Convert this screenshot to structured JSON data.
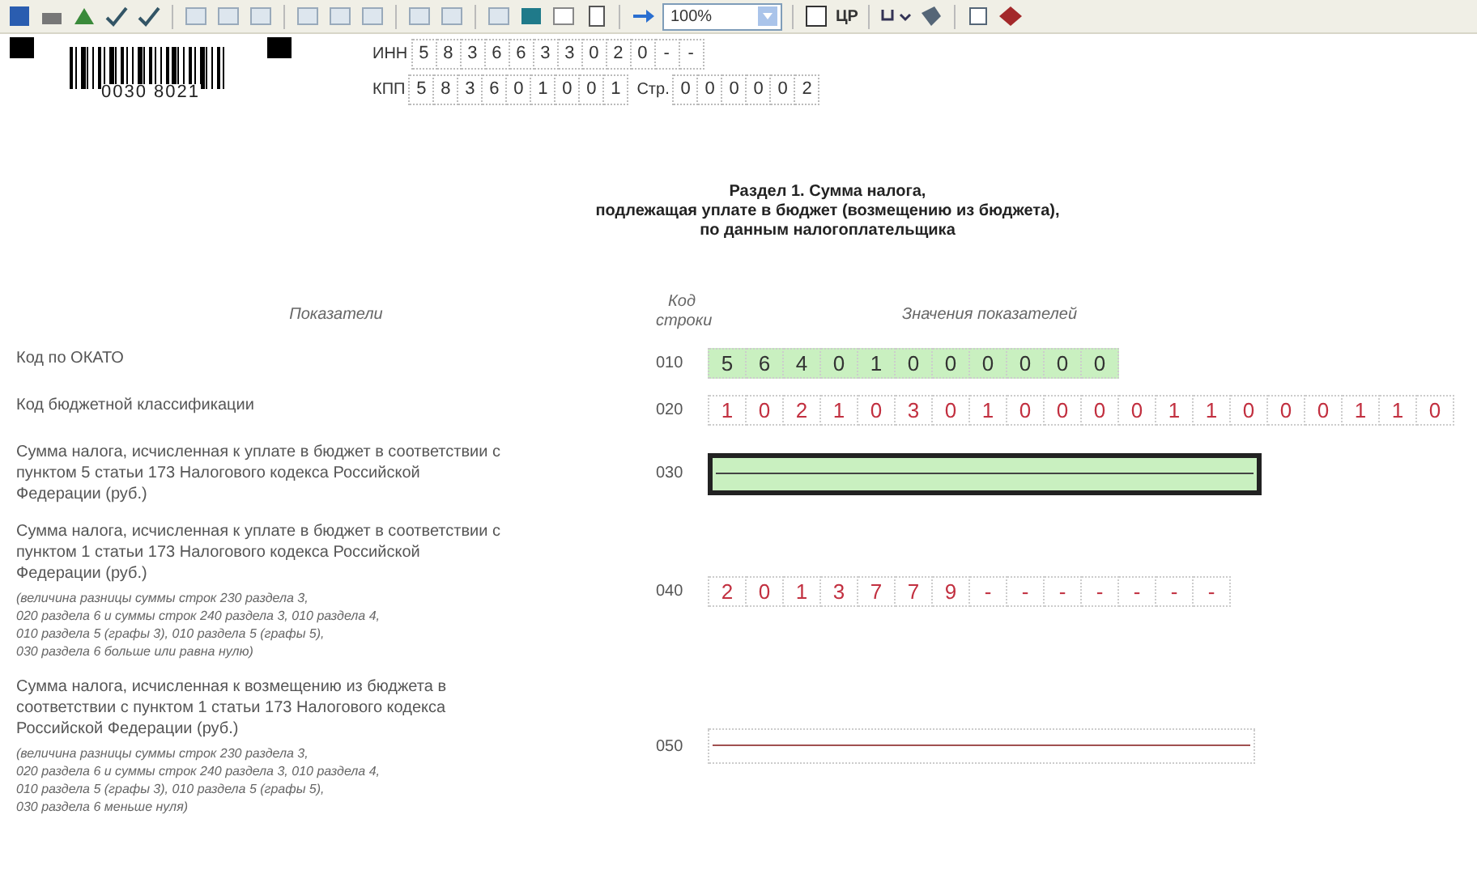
{
  "toolbar": {
    "zoom": "100%",
    "label": "ЦР"
  },
  "header": {
    "barcode_number": "0030 8021",
    "inn": {
      "label": "ИНН",
      "cells": [
        "5",
        "8",
        "3",
        "6",
        "6",
        "3",
        "3",
        "0",
        "2",
        "0",
        "-",
        "-"
      ]
    },
    "kpp": {
      "label": "КПП",
      "cells": [
        "5",
        "8",
        "3",
        "6",
        "0",
        "1",
        "0",
        "0",
        "1"
      ]
    },
    "page": {
      "label": "Стр.",
      "cells": [
        "0",
        "0",
        "0",
        "0",
        "0",
        "2"
      ]
    }
  },
  "title": [
    "Раздел 1. Сумма налога,",
    "подлежащая уплате в бюджет (возмещению из бюджета),",
    "по данным налогоплательщика"
  ],
  "columns": {
    "indicators": "Показатели",
    "code": [
      "Код",
      "строки"
    ],
    "values": "Значения показателей"
  },
  "rows": [
    {
      "code": "010",
      "label": "Код по ОКАТО",
      "kind": "digits",
      "highlighted": true,
      "selected": false,
      "cells": [
        "5",
        "6",
        "4",
        "0",
        "1",
        "0",
        "0",
        "0",
        "0",
        "0",
        "0"
      ]
    },
    {
      "code": "020",
      "label": "Код бюджетной классификации",
      "kind": "digits",
      "highlighted": false,
      "selected": false,
      "cells": [
        "1",
        "0",
        "2",
        "1",
        "0",
        "3",
        "0",
        "1",
        "0",
        "0",
        "0",
        "0",
        "1",
        "1",
        "0",
        "0",
        "0",
        "1",
        "1",
        "0"
      ]
    },
    {
      "code": "030",
      "label": "Сумма налога, исчисленная к уплате в бюджет в соответствии с пунктом 5 статьи 173 Налогового кодекса Российской Федерации (руб.)",
      "kind": "line",
      "highlighted": true,
      "selected": true
    },
    {
      "code": "040",
      "label": "Сумма налога, исчисленная к уплате в бюджет в соответствии с пунктом 1 статьи 173 Налогового кодекса Российской Федерации (руб.)",
      "note": [
        "(величина разницы суммы строк 230 раздела 3,",
        "020 раздела 6 и суммы строк 240 раздела 3, 010 раздела 4,",
        "010 раздела 5 (графы 3), 010 раздела 5 (графы 5),",
        "030 раздела 6 больше или равна нулю)"
      ],
      "kind": "digits",
      "highlighted": false,
      "selected": false,
      "cells": [
        "2",
        "0",
        "1",
        "3",
        "7",
        "7",
        "9",
        "-",
        "-",
        "-",
        "-",
        "-",
        "-",
        "-"
      ]
    },
    {
      "code": "050",
      "label": "Сумма налога, исчисленная к возмещению из бюджета в соответствии с пунктом 1 статьи 173 Налогового кодекса Российской Федерации (руб.)",
      "note": [
        "(величина разницы суммы строк 230 раздела 3,",
        "020 раздела 6 и суммы строк 240 раздела 3, 010 раздела 4,",
        "010 раздела 5 (графы 3), 010 раздела 5 (графы 5),",
        "030 раздела 6 меньше нуля)"
      ],
      "kind": "line",
      "highlighted": false,
      "selected": false
    }
  ]
}
